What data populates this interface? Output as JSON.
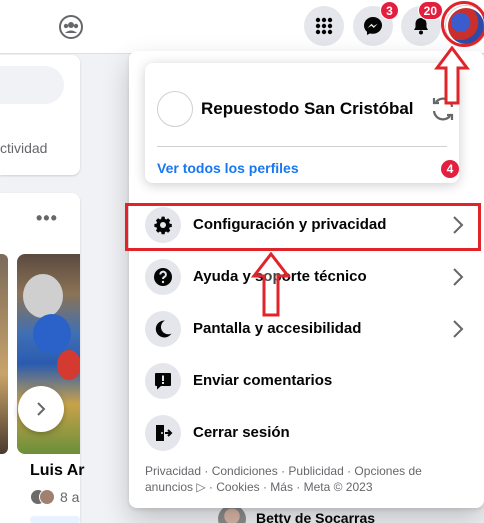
{
  "topbar": {
    "icons": [
      "groups-icon",
      "menu-grid-icon",
      "messenger-icon",
      "notifications-bell-icon",
      "profile-avatar-icon"
    ],
    "messenger_badge": "3",
    "notifications_badge": "20"
  },
  "background": {
    "activity_fragment": "ctividad",
    "more_dots": "•••",
    "story_name": "Luis Ar",
    "story_meta": "8 a",
    "contact_name": "Betty de Socarras"
  },
  "menu": {
    "profile_name": "Repuestodo San Cristóbal",
    "see_all_profiles": "Ver todos los perfiles",
    "profiles_badge": "4",
    "items": [
      {
        "label": "Configuración y privacidad",
        "icon": "gear-icon",
        "has_chevron": true
      },
      {
        "label": "Ayuda y soporte técnico",
        "icon": "question-icon",
        "has_chevron": true
      },
      {
        "label": "Pantalla y accesibilidad",
        "icon": "moon-icon",
        "has_chevron": true
      },
      {
        "label": "Enviar comentarios",
        "icon": "feedback-icon",
        "has_chevron": false
      },
      {
        "label": "Cerrar sesión",
        "icon": "logout-icon",
        "has_chevron": false
      }
    ],
    "footer": "Privacidad · Condiciones · Publicidad · Opciones de anuncios ▷ · Cookies · Más · Meta © 2023"
  },
  "colors": {
    "accent": "#1877f2",
    "badge": "#e41e3f",
    "annotation_red": "#e0242a",
    "icon_bg": "#e4e6eb",
    "page_bg": "#f0f2f5"
  }
}
